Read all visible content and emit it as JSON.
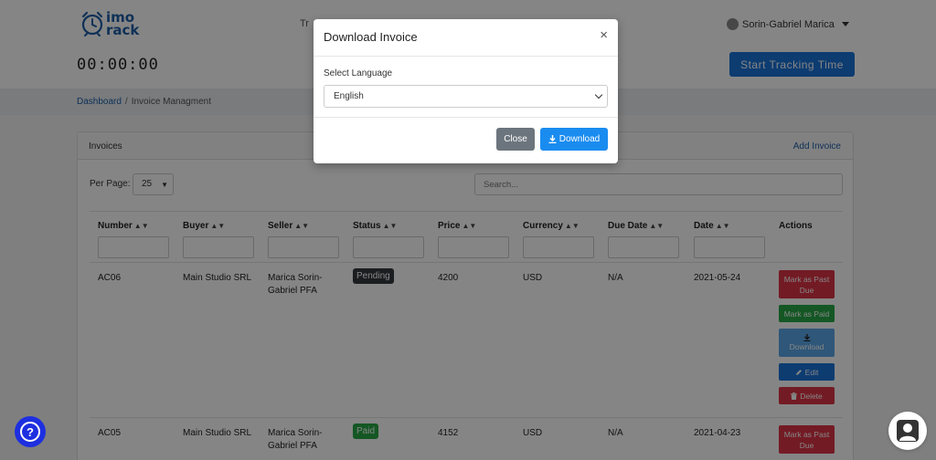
{
  "header": {
    "logo_line1": "imo",
    "logo_line2": "rack",
    "nav_partial": "Tr",
    "user_name": "Sorin-Gabriel Marica",
    "timer": "00:00:00",
    "start_button": "Start Tracking Time"
  },
  "breadcrumb": {
    "home": "Dashboard",
    "separator": "/",
    "current": "Invoice Managment"
  },
  "card": {
    "title": "Invoices",
    "add_link": "Add Invoice",
    "per_page_label": "Per Page:",
    "per_page_value": "25",
    "search_placeholder": "Search..."
  },
  "table": {
    "columns": [
      "Number",
      "Buyer",
      "Seller",
      "Status",
      "Price",
      "Currency",
      "Due Date",
      "Date",
      "Actions"
    ],
    "rows": [
      {
        "number": "AC06",
        "buyer": "Main Studio SRL",
        "seller": "Marica Sorin-Gabriel PFA",
        "status": "Pending",
        "price": "4200",
        "currency": "USD",
        "due_date": "N/A",
        "date": "2021-05-24"
      },
      {
        "number": "AC05",
        "buyer": "Main Studio SRL",
        "seller": "Marica Sorin-Gabriel PFA",
        "status": "Paid",
        "price": "4152",
        "currency": "USD",
        "due_date": "N/A",
        "date": "2021-04-23"
      }
    ],
    "actions": {
      "mark_past_due": "Mark as Past Due",
      "mark_paid": "Mark as Paid",
      "download": "Download",
      "edit": "Edit",
      "delete": "Delete"
    }
  },
  "modal": {
    "title": "Download Invoice",
    "close_symbol": "×",
    "language_label": "Select Language",
    "language_value": "English",
    "close_button": "Close",
    "download_button": "Download"
  },
  "widgets": {
    "help_symbol": "?"
  },
  "colors": {
    "primary": "#1a73d9",
    "danger": "#dc3545",
    "success": "#28a745",
    "secondary": "#6c757d",
    "dark": "#343a40"
  }
}
